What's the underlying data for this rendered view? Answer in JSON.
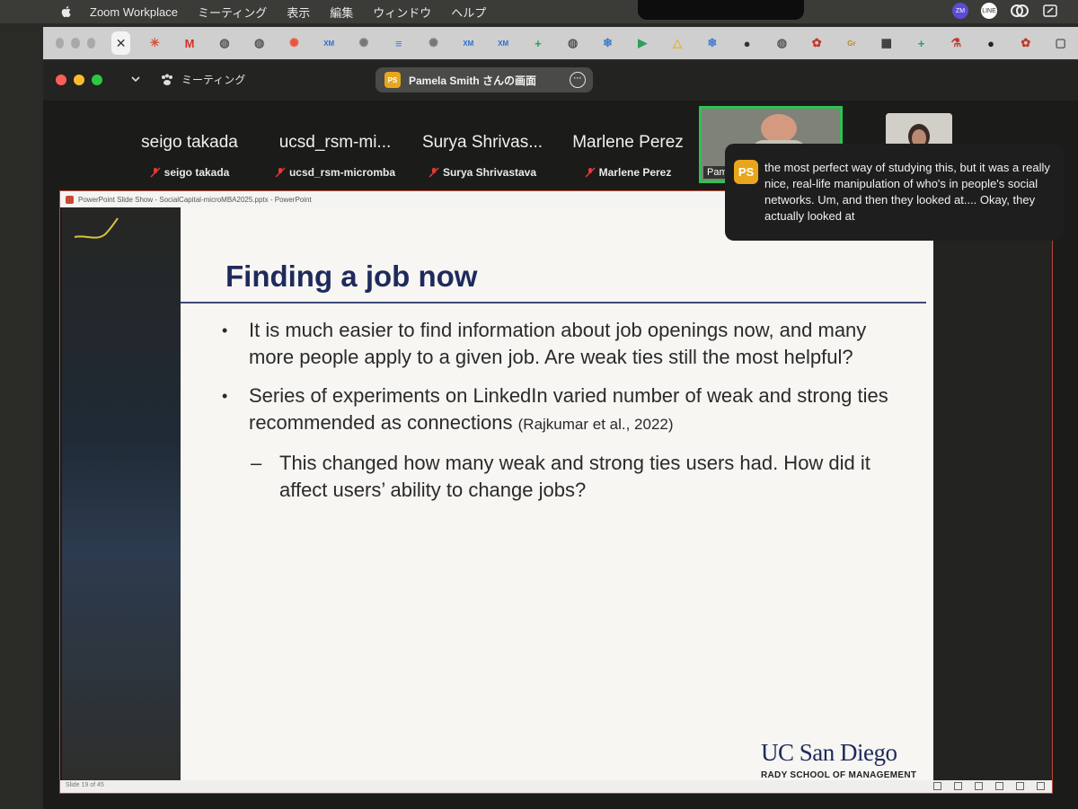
{
  "menubar": {
    "app_name": "Zoom Workplace",
    "menus": [
      "ミーティング",
      "表示",
      "編集",
      "ウィンドウ",
      "ヘルプ"
    ],
    "tray_labels": [
      "ZM",
      "LINE"
    ]
  },
  "browser_tabs": {
    "favicons": [
      {
        "icon": "asterisk-icon",
        "glyph": "✳",
        "color": "#d4553a"
      },
      {
        "icon": "gmail-icon",
        "glyph": "M",
        "color": "#d93025"
      },
      {
        "icon": "globe-icon",
        "glyph": "◍",
        "color": "#555555"
      },
      {
        "icon": "globe-icon",
        "glyph": "◍",
        "color": "#555555"
      },
      {
        "icon": "sunflower-icon",
        "glyph": "✺",
        "color": "#e8553e"
      },
      {
        "icon": "xm-icon",
        "glyph": "XM",
        "color": "#2b6fd6"
      },
      {
        "icon": "dots-icon",
        "glyph": "✺",
        "color": "#777777"
      },
      {
        "icon": "docs-icon",
        "glyph": "≡",
        "color": "#4a7fe0"
      },
      {
        "icon": "dots-icon",
        "glyph": "✺",
        "color": "#777777"
      },
      {
        "icon": "xm-icon",
        "glyph": "XM",
        "color": "#2b6fd6"
      },
      {
        "icon": "xm-icon",
        "glyph": "XM",
        "color": "#2b6fd6"
      },
      {
        "icon": "sheets-icon",
        "glyph": "+",
        "color": "#1fa45a"
      },
      {
        "icon": "globe-icon",
        "glyph": "◍",
        "color": "#555555"
      },
      {
        "icon": "snowflake-icon",
        "glyph": "❄",
        "color": "#3d7bd4"
      },
      {
        "icon": "play-store-icon",
        "glyph": "▶",
        "color": "#2f9e5a"
      },
      {
        "icon": "drive-icon",
        "glyph": "△",
        "color": "#e3b23c"
      },
      {
        "icon": "snowflake-icon",
        "glyph": "❄",
        "color": "#3d7bd4"
      },
      {
        "icon": "circle-icon",
        "glyph": "●",
        "color": "#333333"
      },
      {
        "icon": "globe-icon",
        "glyph": "◍",
        "color": "#555555"
      },
      {
        "icon": "bug-icon",
        "glyph": "✿",
        "color": "#c0392b"
      },
      {
        "icon": "key-icon",
        "glyph": "Gr",
        "color": "#b58b1e"
      },
      {
        "icon": "grid-icon",
        "glyph": "▦",
        "color": "#333333"
      },
      {
        "icon": "sheets-icon",
        "glyph": "+",
        "color": "#1fa45a"
      },
      {
        "icon": "flask-icon",
        "glyph": "⚗",
        "color": "#c0392b"
      },
      {
        "icon": "github-icon",
        "glyph": "●",
        "color": "#222222"
      },
      {
        "icon": "bug-icon",
        "glyph": "✿",
        "color": "#c0392b"
      },
      {
        "icon": "square-icon",
        "glyph": "▢",
        "color": "#555555"
      }
    ]
  },
  "zoom": {
    "meeting_label": "ミーティング",
    "share_pill": {
      "initials": "PS",
      "label": "Pamela Smith さんの画面"
    },
    "participants": [
      {
        "display": "seigo takada",
        "name": "seigo takada"
      },
      {
        "display": "ucsd_rsm-mi...",
        "name": "ucsd_rsm-micromba"
      },
      {
        "display": "Surya Shrivas...",
        "name": "Surya Shrivastava"
      },
      {
        "display": "Marlene Perez",
        "name": "Marlene Perez"
      }
    ],
    "active_video_name": "Pam",
    "colors": {
      "accent_green": "#2fc253",
      "badge_orange": "#e8a61c",
      "mute_red": "#e53935"
    }
  },
  "caption": {
    "initials": "PS",
    "text": "the most perfect way of studying this, but it was a really nice, real-life manipulation of who's in people's social networks. Um, and then they looked at.... Okay, they actually looked at"
  },
  "powerpoint": {
    "window_title": "PowerPoint Slide Show  -  SocialCapital-microMBA2025.pptx  -  PowerPoint",
    "status": "Slide 19 of 45"
  },
  "slide": {
    "title": "Finding a job now",
    "bullet1": "It is much easier to find information about job openings now, and many more people apply to a given job. Are weak ties still the most helpful?",
    "bullet2": "Series of experiments on LinkedIn varied number of weak and strong ties recommended as connections",
    "bullet2_citation": "(Rajkumar et al., 2022)",
    "sub_dash": "–",
    "subbullet": "This changed how many weak and strong ties users had. How did it affect users’ ability to change jobs?",
    "logo_main": "UC San Diego",
    "logo_sub": "RADY SCHOOL OF MANAGEMENT",
    "colors": {
      "title": "#1f2a5c",
      "rule": "#3d4a7a"
    }
  }
}
